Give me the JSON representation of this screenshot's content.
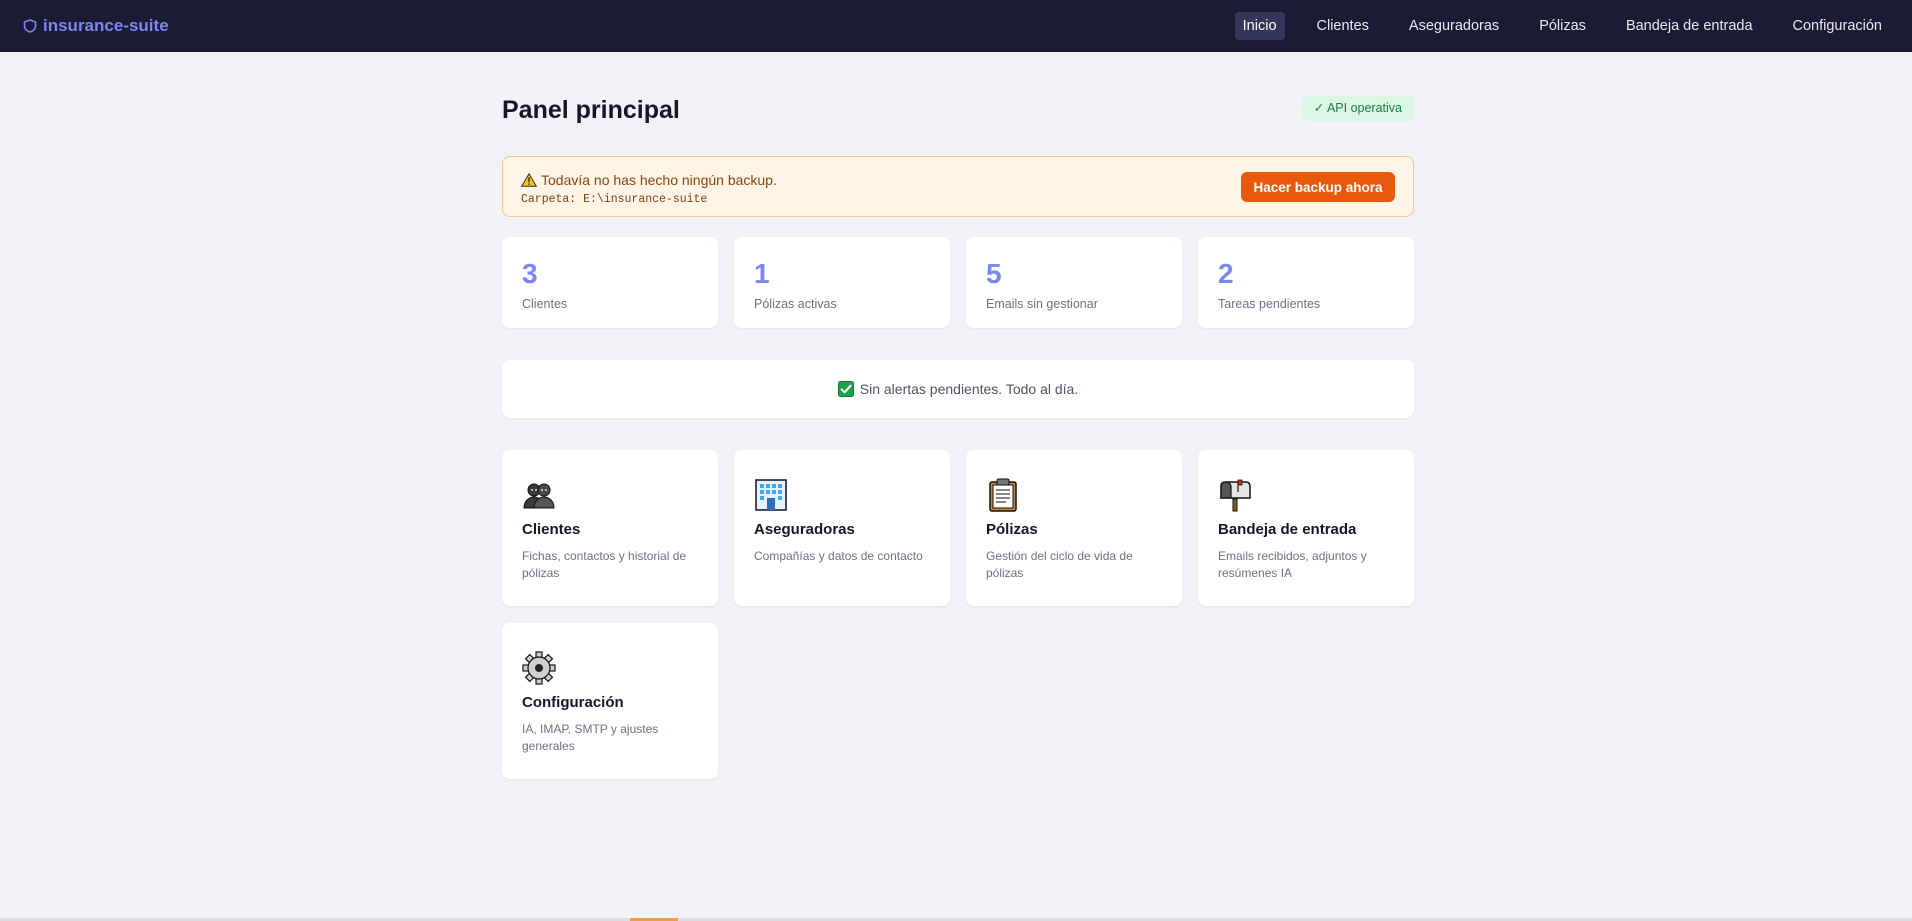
{
  "app": {
    "title": "insurance-suite",
    "icon": "shield-icon"
  },
  "nav": {
    "items": [
      {
        "label": "Inicio",
        "active": true
      },
      {
        "label": "Clientes",
        "active": false
      },
      {
        "label": "Aseguradoras",
        "active": false
      },
      {
        "label": "Pólizas",
        "active": false
      },
      {
        "label": "Bandeja de entrada",
        "active": false
      },
      {
        "label": "Configuración",
        "active": false
      }
    ]
  },
  "page": {
    "title": "Panel principal",
    "api_status": "✓ API operativa"
  },
  "backup": {
    "icon": "warning-icon",
    "message": "Todavía no has hecho ningún backup.",
    "path": "Carpeta: E:\\insurance-suite",
    "button_label": "Hacer backup ahora"
  },
  "stats": [
    {
      "value": "3",
      "label": "Clientes"
    },
    {
      "value": "1",
      "label": "Pólizas activas"
    },
    {
      "value": "5",
      "label": "Emails sin gestionar"
    },
    {
      "value": "2",
      "label": "Tareas pendientes"
    }
  ],
  "alerts": {
    "icon": "check-box-icon",
    "message": "Sin alertas pendientes. Todo al día."
  },
  "modules": [
    {
      "icon": "people-icon",
      "title": "Clientes",
      "description": "Fichas, contactos y historial de pólizas"
    },
    {
      "icon": "office-building-icon",
      "title": "Aseguradoras",
      "description": "Compañías y datos de contacto"
    },
    {
      "icon": "clipboard-icon",
      "title": "Pólizas",
      "description": "Gestión del ciclo de vida de pólizas"
    },
    {
      "icon": "mailbox-icon",
      "title": "Bandeja de entrada",
      "description": "Emails recibidos, adjuntos y resúmenes IA"
    },
    {
      "icon": "gear-icon",
      "title": "Configuración",
      "description": "IA, IMAP, SMTP y ajustes generales"
    }
  ],
  "colors": {
    "topbar": "#1b1c33",
    "accent": "#7b86f5",
    "backup_button": "#e8590c",
    "api_badge_bg": "#dcf6e6",
    "api_badge_text": "#1e7a3e"
  }
}
